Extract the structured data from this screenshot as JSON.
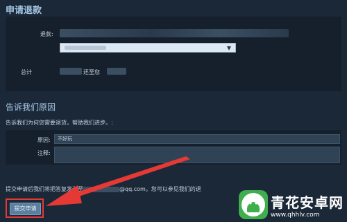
{
  "refund_section": {
    "title": "申请退款",
    "refund_label": "退款:",
    "total_label": "总计",
    "total_suffix": "还至您"
  },
  "reason_section": {
    "title": "告诉我们原因",
    "prompt": "告诉我们为何您需要退货，帮助我们进步。:",
    "reason_label": "原因:",
    "reason_value": "不好玩",
    "note_label": "注释:"
  },
  "footer": {
    "notice_start": "提交申请后我们将把答复发送至",
    "email_suffix": "@qq.com。您可以参见",
    "notice_end": "我们的退"
  },
  "submit_label": "提交申请",
  "watermark": {
    "title": "青花安卓网",
    "url": "www.qhhlv.com",
    "icon": "android-robot-icon"
  },
  "colors": {
    "background": "#1b2838",
    "accent": "#a5c7e4",
    "highlight": "#e53935",
    "brand_green": "#3fae4d"
  }
}
